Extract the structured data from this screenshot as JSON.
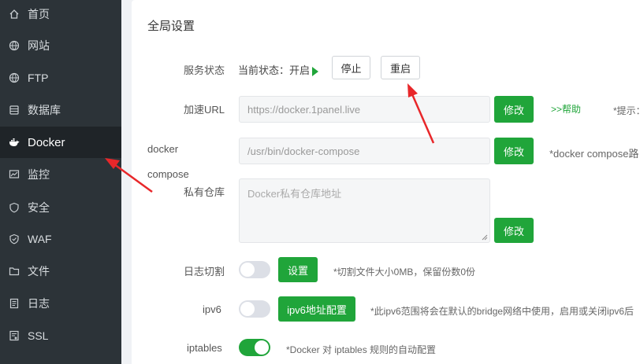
{
  "sidebar": {
    "items": [
      {
        "label": "首页",
        "icon": "home-icon"
      },
      {
        "label": "网站",
        "icon": "globe-icon"
      },
      {
        "label": "FTP",
        "icon": "globe-icon"
      },
      {
        "label": "数据库",
        "icon": "database-icon"
      },
      {
        "label": "Docker",
        "icon": "docker-icon",
        "active": true
      },
      {
        "label": "监控",
        "icon": "monitor-icon"
      },
      {
        "label": "安全",
        "icon": "shield-icon"
      },
      {
        "label": "WAF",
        "icon": "shield-icon"
      },
      {
        "label": "文件",
        "icon": "folder-icon"
      },
      {
        "label": "日志",
        "icon": "log-icon"
      },
      {
        "label": "SSL",
        "icon": "certificate-icon"
      }
    ]
  },
  "settings": {
    "title": "全局设置",
    "service": {
      "label": "服务状态",
      "status_text": "当前状态：开启",
      "stop_label": "停止",
      "restart_label": "重启"
    },
    "mirror": {
      "label": "加速URL",
      "value": "https://docker.1panel.live",
      "edit_label": "修改",
      "help_label": ">>帮助",
      "hint": "*提示："
    },
    "compose": {
      "label_line1": "docker",
      "label_line2": "compose",
      "value": "/usr/bin/docker-compose",
      "edit_label": "修改",
      "hint": "*docker compose路"
    },
    "registry": {
      "label": "私有仓库",
      "placeholder": "Docker私有仓库地址",
      "edit_label": "修改"
    },
    "log_rotate": {
      "label": "日志切割",
      "enabled": false,
      "button_label": "设置",
      "hint": "*切割文件大小0MB，保留份数0份"
    },
    "ipv6": {
      "label": "ipv6",
      "enabled": false,
      "button_label": "ipv6地址配置",
      "hint": "*此ipv6范围将会在默认的bridge网络中使用，启用或关闭ipv6后"
    },
    "iptables": {
      "label": "iptables",
      "enabled": true,
      "hint": "*Docker 对 iptables 规则的自动配置"
    }
  },
  "colors": {
    "accent": "#20a53a",
    "sidebar_bg": "#2c3338",
    "annotation_arrow": "#e8272a"
  }
}
